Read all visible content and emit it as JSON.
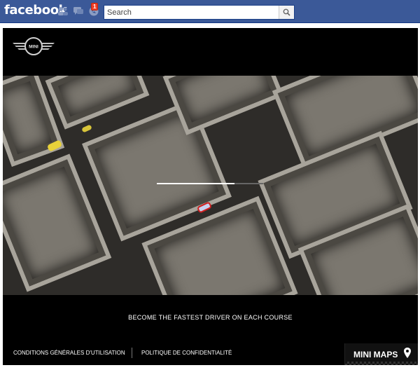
{
  "facebook": {
    "logo_text": "facebook",
    "notification_count": "1",
    "search": {
      "placeholder": "Search"
    },
    "icons": [
      "friends-icon",
      "messages-icon",
      "notifications-icon",
      "search-icon"
    ]
  },
  "app": {
    "brand": "MINI",
    "video": {
      "progress": 0.73
    },
    "tagline": "BECOME THE FASTEST DRIVER ON EACH COURSE",
    "footer": {
      "terms": "CONDITIONS GÉNÉRALES D'UTILISATION",
      "privacy": "POLITIQUE DE CONFIDENTIALITÉ",
      "product": "MINI MAPS"
    }
  },
  "colors": {
    "facebook_blue": "#3b5998",
    "badge_red": "#f03d25",
    "app_background": "#000000"
  }
}
